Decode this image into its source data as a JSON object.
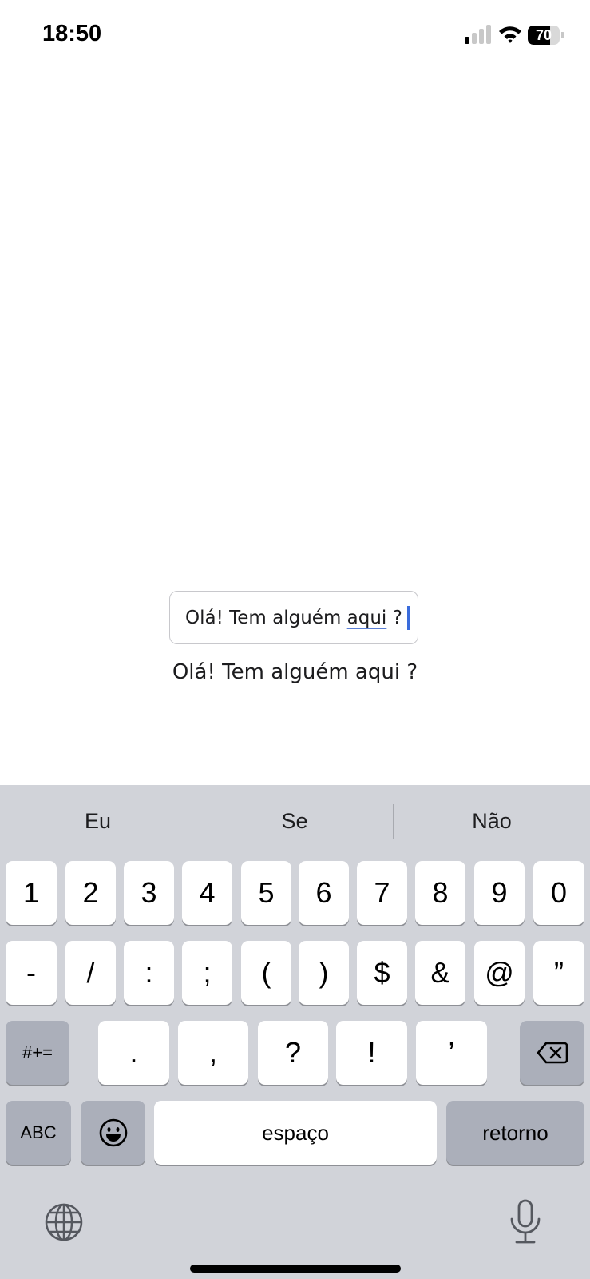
{
  "status_bar": {
    "time": "18:50",
    "battery_level": "70",
    "icons": [
      "cellular-signal-icon",
      "wifi-icon",
      "battery-icon"
    ]
  },
  "input": {
    "value_prefix": "Olá! Tem alguém ",
    "value_marked": "aqui",
    "value_suffix": " ?"
  },
  "echo_text": "Olá! Tem alguém aqui ?",
  "keyboard": {
    "suggestions": [
      "Eu",
      "Se",
      "Não"
    ],
    "row1": [
      "1",
      "2",
      "3",
      "4",
      "5",
      "6",
      "7",
      "8",
      "9",
      "0"
    ],
    "row2": [
      "-",
      "/",
      ":",
      ";",
      "(",
      ")",
      "$",
      "&",
      "@",
      "”"
    ],
    "row3_symbols_key": "#+=",
    "row3": [
      ".",
      ",",
      "?",
      "!",
      "’"
    ],
    "row4_abc_key": "ABC",
    "space_label": "espaço",
    "return_label": "retorno",
    "bottom_icons": [
      "globe-icon",
      "microphone-icon"
    ]
  },
  "colors": {
    "keyboard_bg": "#d1d3d9",
    "key_bg": "#ffffff",
    "function_key_bg": "#abafba",
    "caret": "#3a6cdc"
  }
}
